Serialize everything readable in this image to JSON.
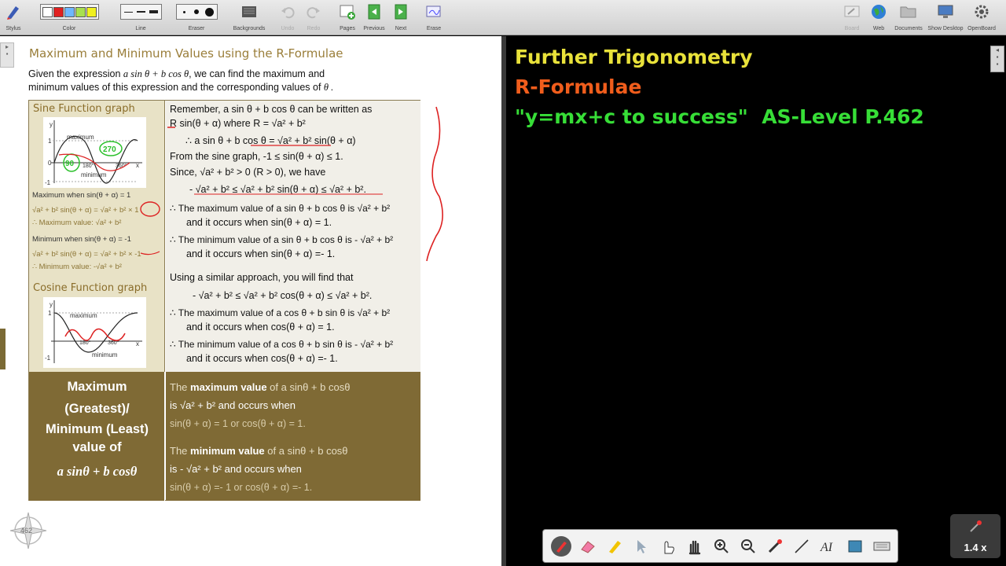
{
  "toolbar": {
    "stylus": "Stylus",
    "color": "Color",
    "line": "Line",
    "eraser": "Eraser",
    "backgrounds": "Backgrounds",
    "undo": "Undo",
    "redo": "Redo",
    "pages": "Pages",
    "previous": "Previous",
    "next": "Next",
    "erase": "Erase",
    "board": "Board",
    "web": "Web",
    "documents": "Documents",
    "show_desktop": "Show Desktop",
    "openboard": "OpenBoard",
    "colors": [
      "#ffffff",
      "#e02020",
      "#6fb7ff",
      "#a8e050",
      "#f0f020"
    ]
  },
  "page": {
    "heading": "Maximum and Minimum Values using the R-Formulae",
    "intro_1": "Given the expression",
    "intro_expr": "a sin θ + b cos θ",
    "intro_2": ", we can find the maximum and",
    "intro_3": "minimum values of this expression and the corresponding values of",
    "intro_theta": "θ .",
    "sine_title": "Sine Function graph",
    "cosine_title": "Cosine Function graph",
    "graph": {
      "y": "y",
      "x": "x",
      "one": "1",
      "zero": "0",
      "neg_one": "-1",
      "maximum": "maximum",
      "minimum": "minimum",
      "t180": "180°",
      "t360": "360°",
      "c180": "180°",
      "c360": "360°"
    },
    "left_notes": {
      "max_when": "Maximum when  sin(θ + α) = 1",
      "max_eq": "√a² + b² sin(θ + α) = √a² + b² × 1",
      "max_val": "∴  Maximum value: √a² + b²",
      "min_when": "Minimum when  sin(θ + α) = -1",
      "min_eq": "√a² + b² sin(θ + α) = √a² + b² × -1",
      "min_val": "∴  Minimum value: -√a² + b²"
    },
    "right": {
      "r1": "Remember,  a sin θ + b cos θ  can be written as",
      "r2": "R sin(θ + α) where  R = √a² + b²",
      "r3": "∴   a sin θ + b cos θ  = √a² + b² sin(θ + α)",
      "r4": "From the sine graph,  -1 ≤ sin(θ + α) ≤ 1.",
      "r5": "Since,  √a² + b² > 0  (R > 0), we have",
      "r6": "- √a² + b² ≤ √a² + b² sin(θ + α) ≤ √a² + b².",
      "r7": "∴ The maximum value of a sin θ  + b cos θ  is √a² + b²",
      "r8": "and it occurs when  sin(θ + α) = 1.",
      "r9": "∴  The minimum value of a sin θ  + b cos θ  is - √a² + b²",
      "r10": "and it occurs when  sin(θ + α) =- 1.",
      "r11": "Using a similar approach, you will find that",
      "r12": "- √a² + b² ≤ √a² + b² cos(θ + α) ≤ √a² + b².",
      "r13": "∴ The maximum value of a cos θ  + b sin θ  is √a² + b²",
      "r14": "and it occurs when  cos(θ + α) = 1.",
      "r15": "∴  The minimum value of a cos θ  + b sin θ  is - √a² + b²",
      "r16": "and it occurs when  cos(θ + α) =- 1."
    },
    "summary": {
      "l1": "Maximum",
      "l2": "(Greatest)/",
      "l3": "Minimum (Least)",
      "l4": "value of",
      "l5": "a sinθ  + b cosθ",
      "mx1a": "The ",
      "mx1b": "maximum value",
      "mx1c": " of  a sinθ  + b cosθ",
      "mx2": "is √a² + b²   and occurs when",
      "mx3": "sin(θ + α) = 1  or   cos(θ + α) = 1.",
      "mn1a": "The ",
      "mn1b": "minimum value",
      "mn1c": " of  a sinθ  + b cosθ",
      "mn2": "is - √a² + b²   and occurs when",
      "mn3": "sin(θ + α) =- 1  or   cos(θ + α) =- 1."
    },
    "annotations": {
      "a270": "270",
      "a90": "90"
    },
    "page_number": "462"
  },
  "board": {
    "title": "Further Trigonometry",
    "subtitle": "R-Formulae",
    "tagline": "\"y=mx+c to success\"  AS-Level P.462"
  },
  "zoom": "1.4 x"
}
